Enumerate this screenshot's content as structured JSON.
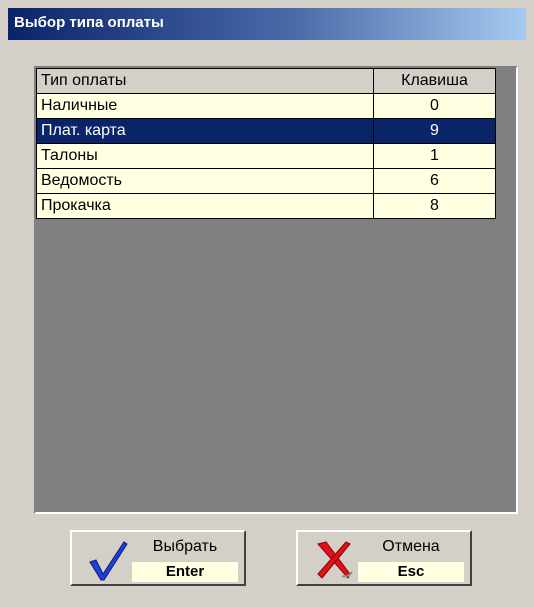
{
  "window": {
    "title": "Выбор типа оплаты"
  },
  "table": {
    "columns": [
      "Тип оплаты",
      "Клавиша"
    ],
    "rows": [
      {
        "name": "Наличные",
        "key": "0"
      },
      {
        "name": "Плат. карта",
        "key": "9"
      },
      {
        "name": "Талоны",
        "key": "1"
      },
      {
        "name": "Ведомость",
        "key": "6"
      },
      {
        "name": "Прокачка",
        "key": "8"
      }
    ],
    "selected_index": 1
  },
  "buttons": {
    "select": {
      "label": "Выбрать",
      "hotkey": "Enter",
      "icon": "checkmark-icon"
    },
    "cancel": {
      "label": "Отмена",
      "hotkey": "Esc",
      "icon": "x-mark-icon"
    }
  },
  "colors": {
    "title_bar_start": "#0a246a",
    "title_bar_end": "#a6caf0",
    "row_background": "#ffffe1",
    "selected_row": "#0a246a",
    "list_background": "#808080",
    "dialog_background": "#d4d0c8",
    "check_color": "#1f3fd6",
    "cross_color": "#e0101a"
  }
}
